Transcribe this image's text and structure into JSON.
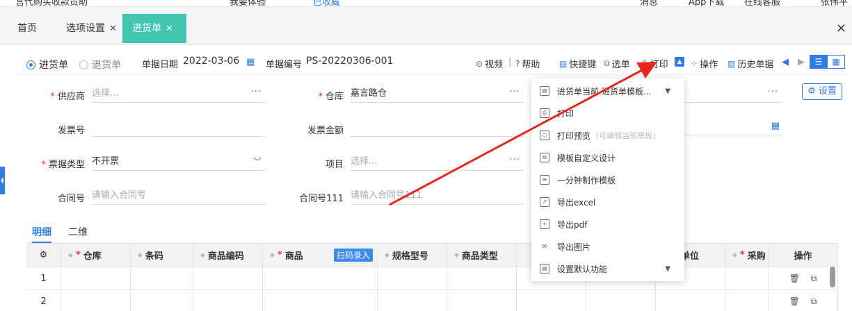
{
  "topbar": {
    "left_text": "宫代购买收款员助",
    "item_2": "我要体验",
    "item_3": "已收藏",
    "notice": "消息",
    "app": "App下载",
    "service": "在线客服",
    "user": "张伟平"
  },
  "tabs": [
    {
      "label": "首页",
      "closable": false,
      "active": false
    },
    {
      "label": "选项设置",
      "closable": true,
      "active": false
    },
    {
      "label": "进货单",
      "closable": true,
      "active": true
    }
  ],
  "tab_close_all": "×",
  "toolbar": {
    "radio_purchase": "进货单",
    "radio_return": "退货单",
    "date_label": "单据日期",
    "date_value": "2022-03-06",
    "no_label": "单据编号",
    "no_value": "PS-20220306-001",
    "video": "视频",
    "help": "帮助",
    "shortcut": "快捷键",
    "select_doc": "选单",
    "print": "打印",
    "operate": "操作",
    "history": "历史单据"
  },
  "form": {
    "supplier_label": "供应商",
    "supplier_placeholder": "选择...",
    "warehouse_label": "仓库",
    "warehouse_value": "嘉言路仓",
    "invoice_no_label": "发票号",
    "invoice_amount_label": "发票金额",
    "bill_type_label": "票据类型",
    "bill_type_value": "不开票",
    "project_label": "项目",
    "project_placeholder": "选择...",
    "contract_label": "合同号",
    "contract_placeholder": "请输入合同号",
    "contract111_label": "合同号111",
    "contract111_placeholder": "请输入合同号111",
    "settings_button": "设置"
  },
  "subtabs": {
    "detail": "明细",
    "two_dim": "二维"
  },
  "table": {
    "headers": [
      "仓库",
      "条码",
      "商品编码",
      "商品",
      "规格型号",
      "商品类型",
      "",
      "",
      "质期单位",
      "采购",
      "操作"
    ],
    "scan_button": "扫码录入",
    "rows": [
      "1",
      "2"
    ]
  },
  "dropdown": {
    "items": [
      {
        "label": "进货单当前",
        "extra": "进货单模板...",
        "caret": true
      },
      {
        "label": "打印"
      },
      {
        "label": "打印预览",
        "hint": "(可编辑当前模板)"
      },
      {
        "label": "模板自定义设计"
      },
      {
        "label": "一分钟制作模板"
      },
      {
        "label": "导出excel"
      },
      {
        "label": "导出pdf"
      },
      {
        "label": "导出图片"
      },
      {
        "label": "设置默认功能",
        "caret": true
      }
    ]
  },
  "colors": {
    "accent": "#2d7be5",
    "active_tab": "#3ec6b0",
    "required": "#e33333",
    "arrow": "#e8261c"
  }
}
